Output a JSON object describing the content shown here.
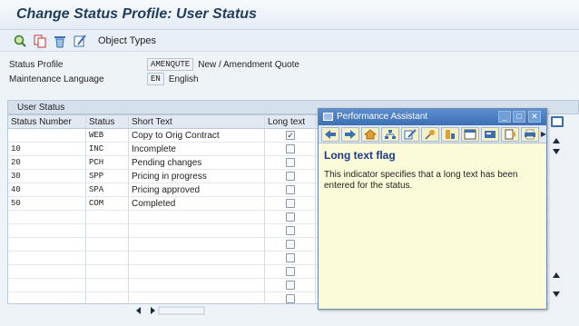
{
  "title": "Change Status Profile: User Status",
  "toolbar": {
    "object_types_label": "Object Types",
    "icons": [
      "choose-icon",
      "copy-icon",
      "delete-icon",
      "edit-icon"
    ]
  },
  "fields": {
    "status_profile_label": "Status Profile",
    "status_profile_value": "AMENQUTE",
    "status_profile_text": "New / Amendment Quote",
    "language_label": "Maintenance Language",
    "language_value": "EN",
    "language_text": "English"
  },
  "user_status": {
    "group_title": "User Status",
    "columns": [
      "Status Number",
      "Status",
      "Short Text",
      "Long text"
    ],
    "rows": [
      {
        "number": "",
        "status": "WEB",
        "short_text": "Copy to Orig Contract",
        "long_text": true
      },
      {
        "number": "10",
        "status": "INC",
        "short_text": "Incomplete",
        "long_text": false
      },
      {
        "number": "20",
        "status": "PCH",
        "short_text": "Pending changes",
        "long_text": false
      },
      {
        "number": "30",
        "status": "SPP",
        "short_text": "Pricing in progress",
        "long_text": false
      },
      {
        "number": "40",
        "status": "SPA",
        "short_text": "Pricing approved",
        "long_text": false
      },
      {
        "number": "50",
        "status": "COM",
        "short_text": "Completed",
        "long_text": false
      },
      {
        "number": "",
        "status": "",
        "short_text": "",
        "long_text": false
      },
      {
        "number": "",
        "status": "",
        "short_text": "",
        "long_text": false
      },
      {
        "number": "",
        "status": "",
        "short_text": "",
        "long_text": false
      },
      {
        "number": "",
        "status": "",
        "short_text": "",
        "long_text": false
      },
      {
        "number": "",
        "status": "",
        "short_text": "",
        "long_text": false
      },
      {
        "number": "",
        "status": "",
        "short_text": "",
        "long_text": false
      },
      {
        "number": "",
        "status": "",
        "short_text": "",
        "long_text": false
      }
    ]
  },
  "performance_assistant": {
    "title": "Performance Assistant",
    "heading": "Long text flag",
    "body": "This indicator specifies that a long text has been entered for the status.",
    "toolbar_icons": [
      "back-icon",
      "forward-icon",
      "home-icon",
      "hierarchy-icon",
      "edit-icon",
      "pin-icon",
      "technical-info-icon",
      "window-icon",
      "bookmark-icon",
      "export-icon",
      "print-icon",
      "more-icon"
    ]
  },
  "colors": {
    "title_text": "#1f3c5c",
    "pa_header": "#3d6fb3",
    "pa_background": "#fcfbd9",
    "pa_heading": "#1b3a8a"
  }
}
